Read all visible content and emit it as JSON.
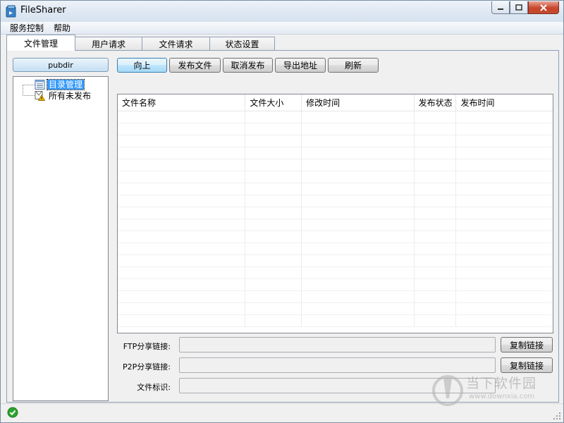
{
  "window": {
    "title": "FileSharer"
  },
  "menu": [
    "服务控制",
    "帮助"
  ],
  "tabs": [
    "文件管理",
    "用户请求",
    "文件请求",
    "状态设置"
  ],
  "left": {
    "pubdir_label": "pubdir",
    "tree": [
      "目录管理",
      "所有未发布"
    ]
  },
  "toolbar": [
    "向上",
    "发布文件",
    "取消发布",
    "导出地址",
    "刷新"
  ],
  "table": {
    "columns": [
      "文件名称",
      "文件大小",
      "修改时间",
      "发布状态",
      "发布时间"
    ],
    "rows": []
  },
  "fields": {
    "ftp_label": "FTP分享链接:",
    "ftp_value": "",
    "p2p_label": "P2P分享链接:",
    "p2p_value": "",
    "id_label": "文件标识:",
    "id_value": "",
    "copy_label": "复制链接"
  },
  "watermark": {
    "text": "当下软件园",
    "url": "www.downxia.com"
  },
  "colors": {
    "selection": "#3399ff",
    "status_ok": "#2ea32e"
  }
}
